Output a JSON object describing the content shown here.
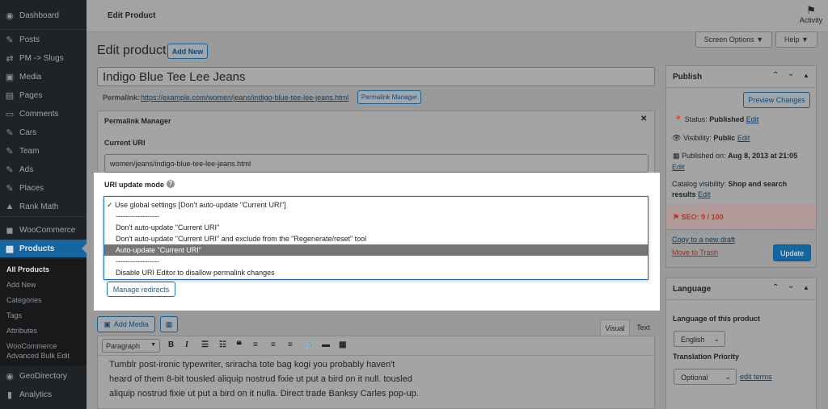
{
  "sidebar": {
    "items": [
      {
        "label": "Dashboard",
        "icon": "dashboard-icon",
        "glyph": "◉"
      },
      {
        "label": "Posts",
        "icon": "pin-icon",
        "glyph": "✎"
      },
      {
        "label": "PM -> Slugs",
        "icon": "shuffle-icon",
        "glyph": "⇄"
      },
      {
        "label": "Media",
        "icon": "media-icon",
        "glyph": "▣"
      },
      {
        "label": "Pages",
        "icon": "pages-icon",
        "glyph": "▤"
      },
      {
        "label": "Comments",
        "icon": "comments-icon",
        "glyph": "▭"
      },
      {
        "label": "Cars",
        "icon": "pin-icon",
        "glyph": "✎"
      },
      {
        "label": "Team",
        "icon": "pin-icon",
        "glyph": "✎"
      },
      {
        "label": "Ads",
        "icon": "pin-icon",
        "glyph": "✎"
      },
      {
        "label": "Places",
        "icon": "pin-icon",
        "glyph": "✎"
      },
      {
        "label": "Rank Math",
        "icon": "rankmath-icon",
        "glyph": "▲"
      },
      {
        "label": "WooCommerce",
        "icon": "woocommerce-icon",
        "glyph": "◼"
      },
      {
        "label": "Products",
        "icon": "products-icon",
        "glyph": "▦"
      },
      {
        "label": "GeoDirectory",
        "icon": "geodirectory-icon",
        "glyph": "◉"
      },
      {
        "label": "Analytics",
        "icon": "analytics-icon",
        "glyph": "▮"
      }
    ],
    "submenu": [
      "All Products",
      "Add New",
      "Categories",
      "Tags",
      "Attributes",
      "WooCommerce",
      "Advanced Bulk Edit"
    ]
  },
  "topbar": {
    "title": "Edit Product",
    "activity": "Activity"
  },
  "header": {
    "heading": "Edit product",
    "add_new": "Add New",
    "screen_options": "Screen Options ▼",
    "help": "Help ▼"
  },
  "post": {
    "title": "Indigo Blue Tee Lee Jeans",
    "permalink_label": "Permalink:",
    "permalink_url": "https://example.com/women/jeans/indigo-blue-tee-lee-jeans.html",
    "permalink_button": "Permalink Manager"
  },
  "permalink_manager": {
    "title": "Permalink Manager",
    "current_uri_label": "Current URI",
    "current_uri": "women/jeans/indigo-blue-tee-lee-jeans.html",
    "update_mode_label": "URI update mode",
    "options": [
      "✓ Use global settings [Don't auto-update \"Current URI\"]",
      "------------------",
      "Don't auto-update \"Current URI\"",
      "Don't auto-update \"Current URI\" and exclude from the \"Regenerate/reset\" tool",
      "Auto-update \"Current URI\"",
      "------------------",
      "Disable URI Editor to disallow permalink changes"
    ],
    "manage_redirects": "Manage redirects"
  },
  "editor": {
    "add_media": "Add Media",
    "tab_visual": "Visual",
    "tab_text": "Text",
    "format": "Paragraph",
    "lines": [
      "Tumblr post-ironic typewriter, sriracha tote bag kogi you probably haven't",
      "heard of them 8-bit tousled aliquip nostrud fixie ut put a bird on it null. tousled",
      "aliquip nostrud fixie ut put a bird on it nulla. Direct trade Banksy Carles pop-up."
    ]
  },
  "publish": {
    "title": "Publish",
    "preview": "Preview Changes",
    "status_label": "Status:",
    "status_value": "Published",
    "edit": "Edit",
    "visibility_label": "Visibility:",
    "visibility_value": "Public",
    "published_label": "Published on:",
    "published_value": "Aug 8, 2013 at 21:05",
    "catalog_label": "Catalog visibility:",
    "catalog_value": "Shop and search",
    "catalog_value2": "results",
    "seo": "SEO: 9 / 100",
    "copy_draft": "Copy to a new draft",
    "trash": "Move to Trash",
    "update": "Update"
  },
  "language": {
    "title": "Language",
    "label": "Language of this product",
    "value": "English",
    "priority_label": "Translation Priority",
    "priority_value": "Optional",
    "edit_terms": "edit terms"
  },
  "colors": {
    "accent": "#1566a0",
    "sidebar": "#1f2326",
    "seo_bad": "#b23a2a"
  }
}
